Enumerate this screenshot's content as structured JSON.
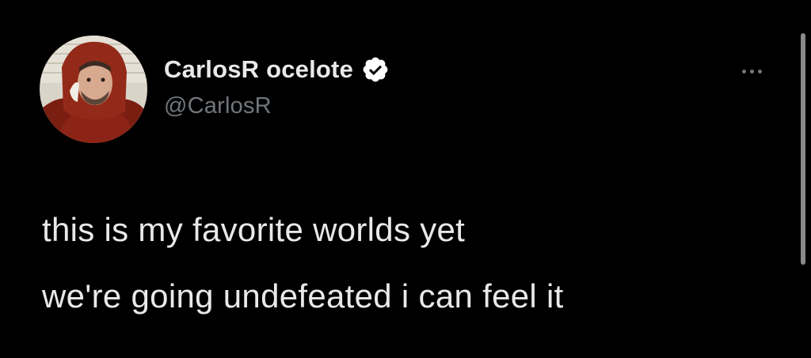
{
  "author": {
    "display_name": "CarlosR ocelote",
    "handle": "@CarlosR",
    "verified": true,
    "avatar_icon": "profile-photo"
  },
  "tweet": {
    "lines": [
      "this is my favorite worlds yet",
      "we're going undefeated i can feel it"
    ]
  },
  "icons": {
    "verified": "verified-badge-icon",
    "more": "more-options-icon"
  },
  "colors": {
    "background": "#000000",
    "primary_text": "#e7e9ea",
    "secondary_text": "#71767b",
    "verified_badge": "#ffffff",
    "scrollbar": "#8a8a8a"
  }
}
